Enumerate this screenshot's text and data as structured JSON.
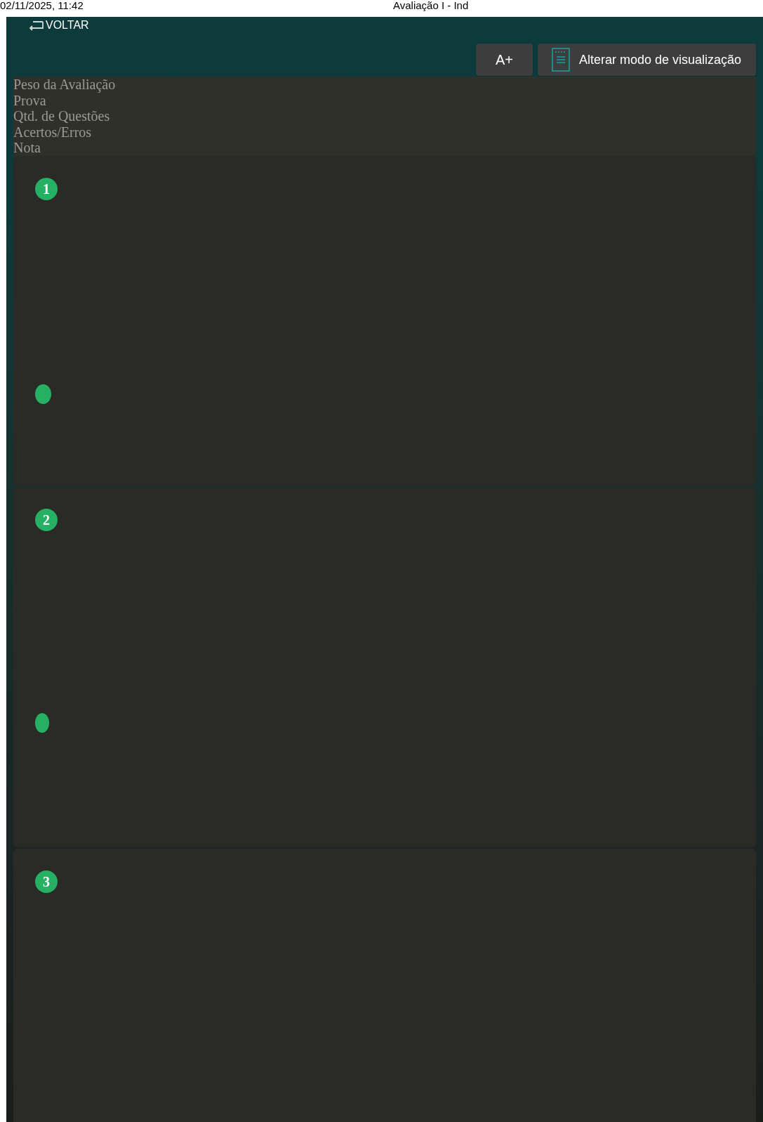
{
  "print_header": {
    "datetime": "02/11/2025, 11:42",
    "title": "Avaliação I - Ind"
  },
  "back_button": {
    "label": "VOLTAR"
  },
  "toolbar": {
    "font_button": "A+",
    "view_button": "Alterar modo de visualização"
  },
  "summary": [
    "Peso da Avaliação",
    "Prova",
    "Qtd. de Questões",
    "Acertos/Erros",
    "Nota"
  ],
  "questions": [
    {
      "number": "1",
      "marker": true
    },
    {
      "number": "2",
      "marker": true
    },
    {
      "number": "3",
      "marker": false
    }
  ]
}
